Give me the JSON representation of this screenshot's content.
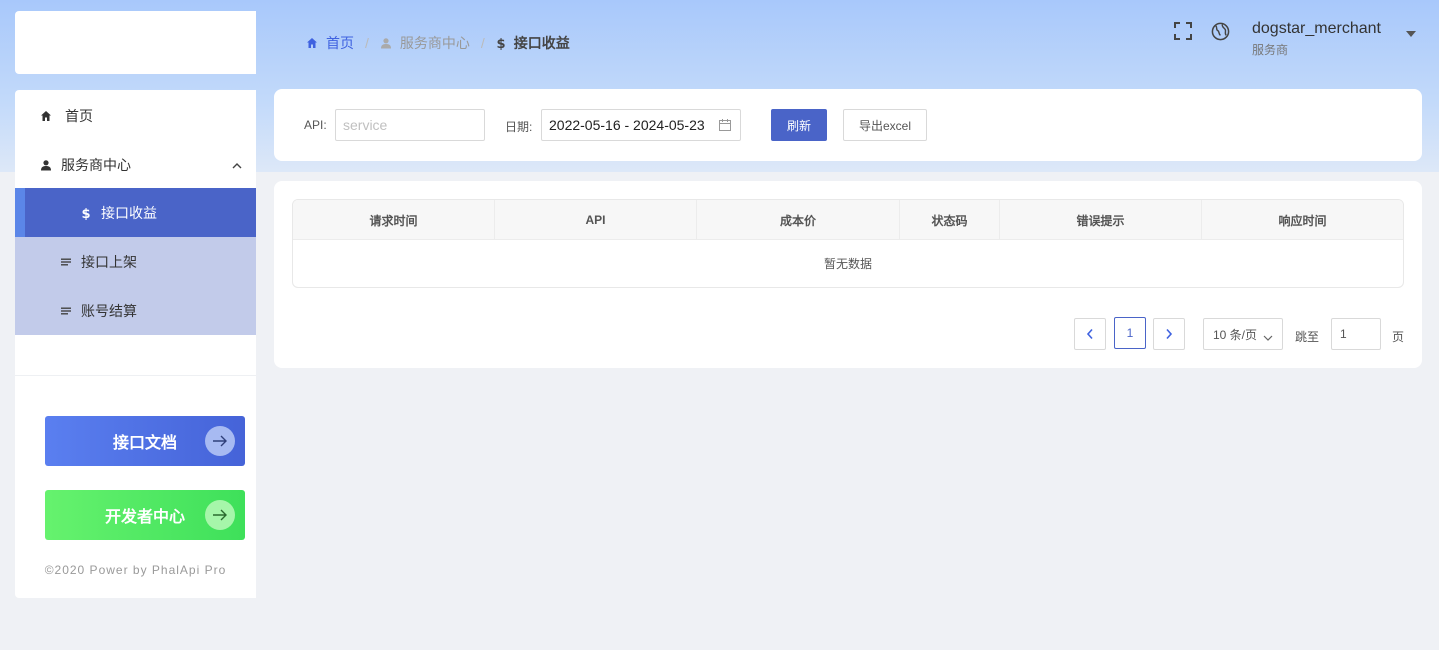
{
  "breadcrumb": {
    "home": "首页",
    "center": "服务商中心",
    "current": "接口收益",
    "separator": "/"
  },
  "user": {
    "name": "dogstar_merchant",
    "role": "服务商"
  },
  "sidebar": {
    "items": [
      {
        "label": "首页",
        "icon": "home-icon"
      },
      {
        "label": "服务商中心",
        "icon": "user-icon"
      },
      {
        "label": "接口收益",
        "icon": "dollar-icon"
      },
      {
        "label": "接口上架",
        "icon": "list-icon"
      },
      {
        "label": "账号结算",
        "icon": "list-icon"
      }
    ],
    "doc_button": "接口文档",
    "dev_button": "开发者中心",
    "copyright": "©2020 Power by PhalApi Pro"
  },
  "filters": {
    "api_label": "API:",
    "api_placeholder": "service",
    "date_label": "日期:",
    "date_range": "2022-05-16 - 2024-05-23",
    "refresh_label": "刷新",
    "export_label": "导出excel"
  },
  "table": {
    "columns": [
      "请求时间",
      "API",
      "成本价",
      "状态码",
      "错误提示",
      "响应时间"
    ],
    "empty_text": "暂无数据"
  },
  "pagination": {
    "current_page": "1",
    "page_size": "10 条/页",
    "jump_label": "跳至",
    "jump_value": "1",
    "page_suffix": "页"
  },
  "colors": {
    "primary": "#4a64c8",
    "accent_blue": "#3f62e0",
    "green": "#4ce85f"
  }
}
